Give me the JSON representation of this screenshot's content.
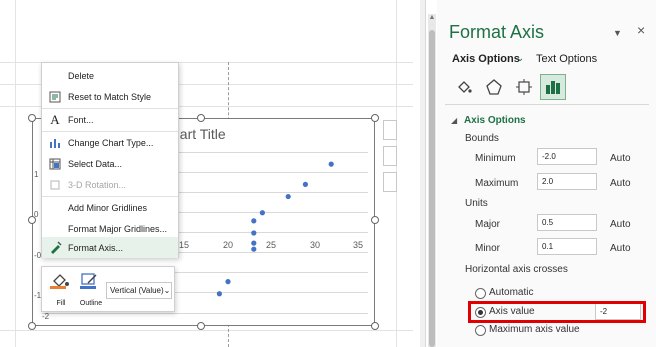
{
  "chart": {
    "title": "hart Title",
    "x_ticks": [
      "15",
      "20",
      "25",
      "30",
      "35"
    ],
    "y_ticks": [
      "1",
      "0",
      "-0.",
      "-1",
      "-2"
    ]
  },
  "chart_data": {
    "type": "scatter",
    "title": "hart Title",
    "xlim": [
      -5,
      35
    ],
    "ylim": [
      -2,
      2
    ],
    "x_tick_labels": [
      "15",
      "20",
      "25",
      "30",
      "35"
    ],
    "points": [
      {
        "x": 19.0,
        "y": -1.5
      },
      {
        "x": 20.0,
        "y": -1.2
      },
      {
        "x": 23.0,
        "y": -0.4
      },
      {
        "x": 23.0,
        "y": -0.25
      },
      {
        "x": 23.0,
        "y": 0.0
      },
      {
        "x": 23.0,
        "y": 0.3
      },
      {
        "x": 24.0,
        "y": 0.5
      },
      {
        "x": 27.0,
        "y": 0.9
      },
      {
        "x": 29.0,
        "y": 1.2
      },
      {
        "x": 32.0,
        "y": 1.7
      }
    ],
    "series_color": "#4472c4",
    "grid": true
  },
  "context_menu": {
    "items": [
      {
        "label": "Delete",
        "icon": "none",
        "disabled": false
      },
      {
        "label": "Reset to Match Style",
        "icon": "reset-style-icon",
        "disabled": false
      },
      {
        "label": "Font...",
        "icon": "font-icon",
        "disabled": false
      },
      {
        "label": "Change Chart Type...",
        "icon": "chart-type-icon",
        "disabled": false
      },
      {
        "label": "Select Data...",
        "icon": "select-data-icon",
        "disabled": false
      },
      {
        "label": "3-D Rotation...",
        "icon": "rotation-icon",
        "disabled": true
      },
      {
        "label": "Add Minor Gridlines",
        "icon": "none",
        "disabled": false
      },
      {
        "label": "Format Major Gridlines...",
        "icon": "none",
        "disabled": false
      },
      {
        "label": "Format Axis...",
        "icon": "format-axis-icon",
        "disabled": false
      }
    ]
  },
  "mini_toolbar": {
    "fill_label": "Fill",
    "outline_label": "Outline",
    "dropdown_value": "Vertical (Value)"
  },
  "pane": {
    "title": "Format Axis",
    "tab_axis_options": "Axis Options",
    "tab_text_options": "Text Options",
    "section_title": "Axis Options",
    "bounds_label": "Bounds",
    "minimum_label": "Minimum",
    "minimum_value": "-2.0",
    "maximum_label": "Maximum",
    "maximum_value": "2.0",
    "units_label": "Units",
    "major_label": "Major",
    "major_value": "0.5",
    "minor_label": "Minor",
    "minor_value": "0.1",
    "auto_label": "Auto",
    "crosses_label": "Horizontal axis crosses",
    "automatic_label": "Automatic",
    "axis_value_label": "Axis value",
    "axis_value_value": "-2",
    "max_axis_value_label": "Maximum axis value"
  },
  "colors": {
    "accent": "#1e7145",
    "marker": "#4472c4",
    "highlight": "#e00000"
  }
}
